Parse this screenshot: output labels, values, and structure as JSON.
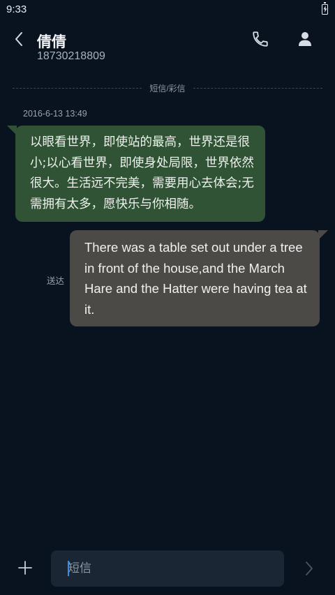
{
  "status_bar": {
    "time": "9:33",
    "battery_icon": "battery-charging-icon"
  },
  "header": {
    "back_icon": "chevron-left-icon",
    "contact_name": "倩倩",
    "contact_number": "18730218809",
    "call_icon": "phone-icon",
    "contact_icon": "person-icon"
  },
  "conversation": {
    "divider_label": "短信/彩信",
    "timestamp": "2016-6-13 13:49",
    "messages": [
      {
        "direction": "incoming",
        "text": "以眼看世界，即使站的最高，世界还是很小;以心看世界，即使身处局限，世界依然很大。生活远不完美，需要用心去体会;无需拥有太多，愿快乐与你相随。"
      },
      {
        "direction": "outgoing",
        "text": "There was a table set out under a tree in front of the house,and the March Hare and the Hatter were having tea at it.",
        "status": "送达"
      }
    ]
  },
  "composer": {
    "attach_icon": "plus-icon",
    "placeholder": "短信",
    "value": "",
    "send_icon": "chevron-right-icon"
  },
  "colors": {
    "background": "#08131f",
    "incoming_bubble": "#305335",
    "outgoing_bubble": "#4b4a47",
    "input_background": "#1a2634",
    "caret": "#3a8dde"
  }
}
